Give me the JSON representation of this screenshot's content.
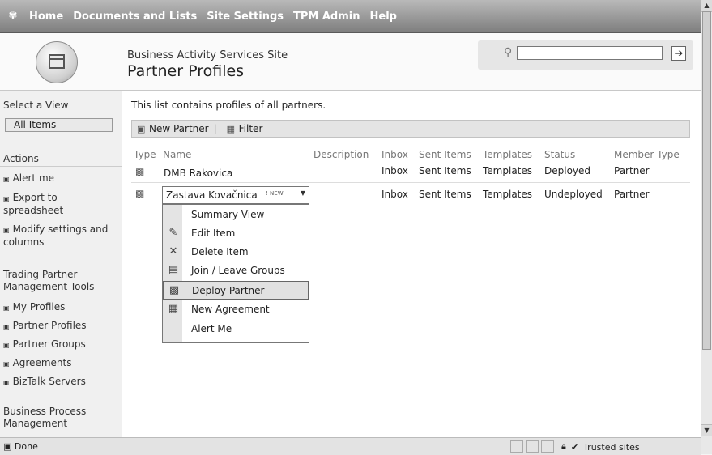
{
  "topnav": {
    "home": "Home",
    "documents": "Documents and Lists",
    "site_settings": "Site Settings",
    "tpm_admin": "TPM Admin",
    "help": "Help"
  },
  "header": {
    "site_title": "Business Activity Services Site",
    "page_title": "Partner Profiles",
    "search_placeholder": ""
  },
  "sidebar": {
    "select_view": "Select a View",
    "view_current": "All Items",
    "actions_title": "Actions",
    "actions": [
      "Alert me",
      "Export to spreadsheet",
      "Modify settings and columns"
    ],
    "tpm_title": "Trading Partner Management Tools",
    "tpm_items": [
      "My Profiles",
      "Partner Profiles",
      "Partner Groups",
      "Agreements",
      "BizTalk Servers"
    ],
    "bpm_title": "Business Process Management"
  },
  "main": {
    "description": "This list contains profiles of all partners.",
    "toolbar": {
      "new_partner": "New Partner",
      "filter": "Filter"
    },
    "columns": [
      "Type",
      "Name",
      "Description",
      "Inbox",
      "Sent Items",
      "Templates",
      "Status",
      "Member Type"
    ],
    "rows": [
      {
        "name": "DMB Rakovica",
        "inbox": "Inbox",
        "sent": "Sent Items",
        "templates": "Templates",
        "status": "Deployed",
        "member": "Partner"
      },
      {
        "name": "Zastava Kovačnica",
        "badge": "! NEW",
        "inbox": "Inbox",
        "sent": "Sent Items",
        "templates": "Templates",
        "status": "Undeployed",
        "member": "Partner"
      }
    ]
  },
  "context_menu": {
    "items": [
      "Summary View",
      "Edit Item",
      "Delete Item",
      "Join / Leave Groups",
      "Deploy Partner",
      "New Agreement",
      "Alert Me"
    ],
    "selected": "Deploy Partner"
  },
  "statusbar": {
    "left": "Done",
    "zone": "Trusted sites"
  },
  "colors": {
    "topbar": "#8a8a8a",
    "menu_selected": "#e1e1e1"
  }
}
